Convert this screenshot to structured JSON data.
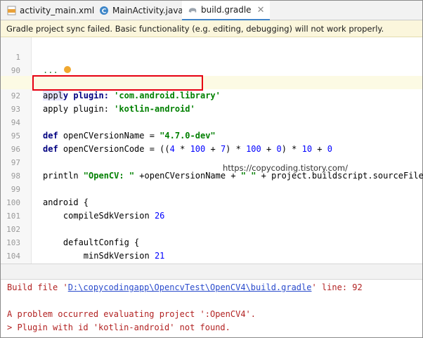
{
  "tabs": [
    {
      "label": "activity_main.xml",
      "icon": "xml-file-icon",
      "active": false
    },
    {
      "label": "MainActivity.java",
      "icon": "java-class-icon",
      "active": false
    },
    {
      "label": "build.gradle",
      "icon": "gradle-elephant-icon",
      "active": true
    }
  ],
  "banner": {
    "message": "Gradle project sync failed. Basic functionality (e.g. editing, debugging) will not work properly."
  },
  "editor": {
    "lines": [
      {
        "num": "1",
        "text": "..."
      },
      {
        "num": "91",
        "parts": [
          "appl",
          "y plugin: ",
          "'com.android.library'"
        ]
      },
      {
        "num": "92",
        "parts": [
          "apply plugin: ",
          "'kotlin-android'"
        ]
      },
      {
        "num": "94",
        "parts": [
          "def",
          " openCVersionName = ",
          "\"4.7.0-dev\""
        ]
      },
      {
        "num": "95",
        "parts": [
          "def",
          " openCVersionCode = ((",
          "4",
          " * ",
          "100",
          " + ",
          "7",
          ") * ",
          "100",
          " + ",
          "0",
          ") * ",
          "10",
          " + ",
          "0"
        ]
      },
      {
        "num": "97",
        "parts": [
          "println ",
          "\"OpenCV: \"",
          " +openCVersionName + ",
          "\" \"",
          " + project.buildscript.sourceFile"
        ]
      },
      {
        "num": "99",
        "parts": [
          "android",
          " {"
        ]
      },
      {
        "num": "100",
        "parts": [
          "    compileSdkVersion ",
          "26"
        ]
      },
      {
        "num": "102",
        "parts": [
          "    defaultConfig",
          " {"
        ]
      },
      {
        "num": "103",
        "parts": [
          "        minSdkVersion ",
          "21"
        ]
      },
      {
        "num": "104",
        "parts": [
          "        targetSdkVersion",
          " ",
          "26"
        ]
      }
    ],
    "blank_line_numbers": [
      "90",
      "93",
      "96",
      "98",
      "101"
    ],
    "watermark": "https://copycoding.tistory.com/"
  },
  "console": {
    "build_file_prefix": "Build file '",
    "build_file_path": "D:\\copycodingapp\\OpencvTest\\OpenCV4\\build.gradle",
    "build_file_suffix": "' line: 92",
    "error_line1": "A problem occurred evaluating project ':OpenCV4'.",
    "error_line2": "> Plugin with id 'kotlin-android' not found."
  }
}
